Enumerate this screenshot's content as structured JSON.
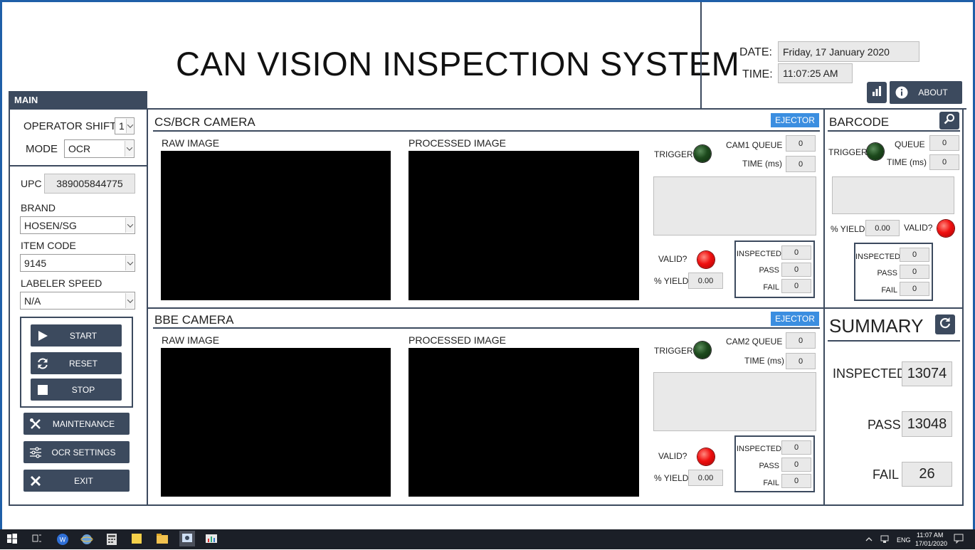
{
  "header": {
    "title": "CAN VISION INSPECTION SYSTEM",
    "date_label": "DATE:",
    "date_value": "Friday, 17 January 2020",
    "time_label": "TIME:",
    "time_value": "11:07:25 AM",
    "about_label": "ABOUT"
  },
  "main": {
    "tab_label": "MAIN",
    "operator_shift_label": "OPERATOR SHIFT",
    "operator_shift_value": "1",
    "mode_label": "MODE",
    "mode_value": "OCR",
    "upc_label": "UPC",
    "upc_value": "389005844775",
    "brand_label": "BRAND",
    "brand_value": "HOSEN/SG",
    "item_code_label": "ITEM CODE",
    "item_code_value": "9145",
    "labeler_speed_label": "LABELER SPEED",
    "labeler_speed_value": "N/A",
    "start_label": "START",
    "reset_label": "RESET",
    "stop_label": "STOP",
    "maintenance_label": "MAINTENANCE",
    "ocr_settings_label": "OCR SETTINGS",
    "exit_label": "EXIT"
  },
  "cam1": {
    "title": "CS/BCR CAMERA",
    "ejector_label": "EJECTOR",
    "raw_label": "RAW IMAGE",
    "processed_label": "PROCESSED IMAGE",
    "trigger_label": "TRIGGER",
    "queue_label": "CAM1 QUEUE",
    "queue_value": "0",
    "time_label": "TIME (ms)",
    "time_value": "0",
    "valid_label": "VALID?",
    "yield_label": "% YIELD",
    "yield_value": "0.00",
    "inspected_label": "INSPECTED",
    "inspected_value": "0",
    "pass_label": "PASS",
    "pass_value": "0",
    "fail_label": "FAIL",
    "fail_value": "0"
  },
  "cam2": {
    "title": "BBE CAMERA",
    "ejector_label": "EJECTOR",
    "raw_label": "RAW IMAGE",
    "processed_label": "PROCESSED IMAGE",
    "trigger_label": "TRIGGER",
    "queue_label": "CAM2 QUEUE",
    "queue_value": "0",
    "time_label": "TIME (ms)",
    "time_value": "0",
    "valid_label": "VALID?",
    "yield_label": "% YIELD",
    "yield_value": "0.00",
    "inspected_label": "INSPECTED",
    "inspected_value": "0",
    "pass_label": "PASS",
    "pass_value": "0",
    "fail_label": "FAIL",
    "fail_value": "0"
  },
  "barcode": {
    "title": "BARCODE",
    "trigger_label": "TRIGGER",
    "queue_label": "QUEUE",
    "queue_value": "0",
    "time_label": "TIME (ms)",
    "time_value": "0",
    "yield_label": "% YIELD",
    "yield_value": "0.00",
    "valid_label": "VALID?",
    "inspected_label": "INSPECTED",
    "inspected_value": "0",
    "pass_label": "PASS",
    "pass_value": "0",
    "fail_label": "FAIL",
    "fail_value": "0"
  },
  "summary": {
    "title": "SUMMARY",
    "inspected_label": "INSPECTED",
    "inspected_value": "13074",
    "pass_label": "PASS",
    "pass_value": "13048",
    "fail_label": "FAIL",
    "fail_value": "26"
  },
  "taskbar": {
    "lang": "ENG",
    "clock_time": "11:07 AM",
    "clock_date": "17/01/2020"
  },
  "colors": {
    "navy": "#3c4a5e",
    "accent_blue": "#3b8ee0",
    "window_border": "#1f5fa8",
    "led_red": "#f01010",
    "led_green": "#1d4a1d"
  }
}
